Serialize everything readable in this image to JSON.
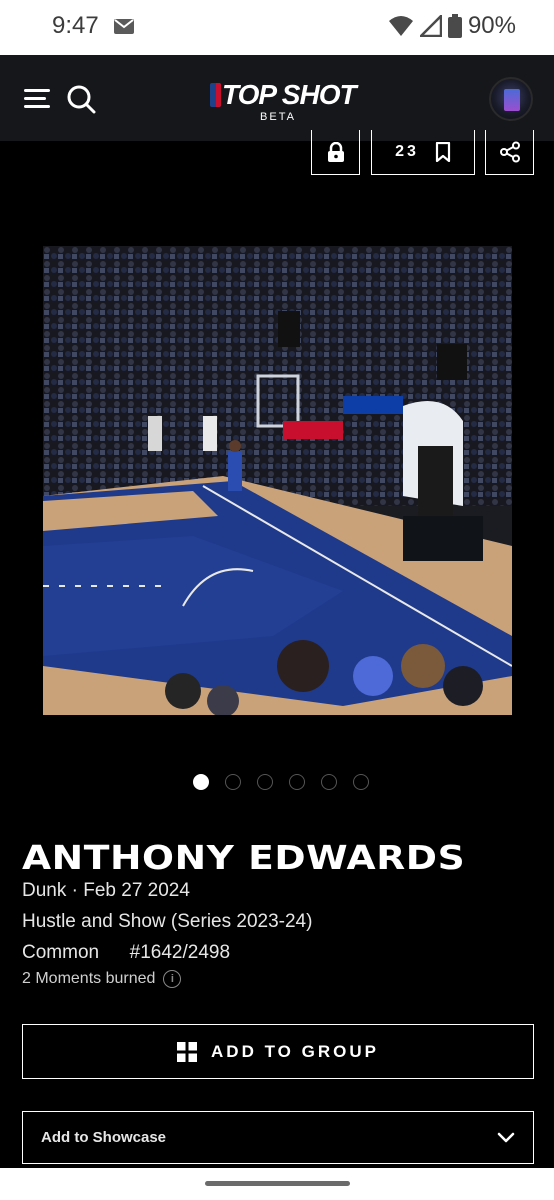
{
  "status_bar": {
    "time": "9:47",
    "battery": "90%",
    "icons": [
      "mail-icon",
      "wifi-icon",
      "signal-icon",
      "battery-icon"
    ]
  },
  "header": {
    "logo_text": "TOP SHOT",
    "logo_sub": "BETA",
    "icons": [
      "menu-icon",
      "search-icon",
      "avatar"
    ]
  },
  "actions": {
    "lock_icon": "lock-icon",
    "save_count": "23",
    "save_icon": "bookmark-icon",
    "share_icon": "share-icon"
  },
  "media": {
    "image_description_icon": "highlight-video-frame",
    "carousel_count": 6,
    "active_index": 0
  },
  "moment": {
    "player_name": "ANTHONY EDWARDS",
    "play_line": "Dunk · Feb 27 2024",
    "set_line": "Hustle and Show (Series 2023-24)",
    "rarity": "Common",
    "serial": "#1642/2498",
    "burned": "2 Moments burned"
  },
  "buttons": {
    "add_to_group": "ADD TO GROUP",
    "add_to_showcase": "Add to Showcase"
  },
  "colors": {
    "background": "#000000",
    "header_bg": "#16171b",
    "court_blue": "#1f3a8a",
    "court_wood": "#c9a27a"
  }
}
